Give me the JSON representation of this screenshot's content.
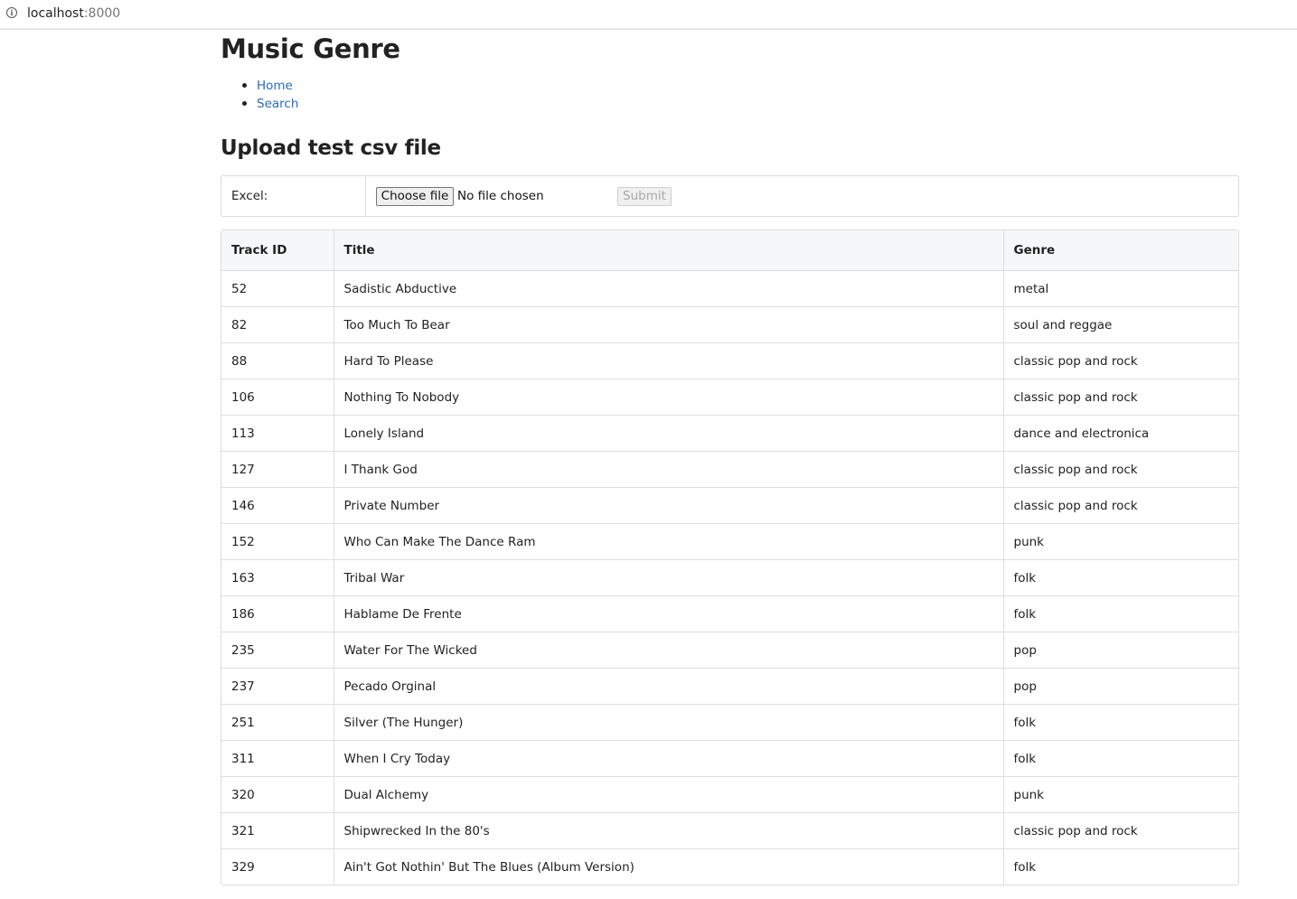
{
  "browser": {
    "url_host": "localhost",
    "url_port": ":8000"
  },
  "page": {
    "title": "Music Genre",
    "nav": [
      {
        "label": "Home"
      },
      {
        "label": "Search"
      }
    ],
    "upload_heading": "Upload test csv file",
    "upload_form": {
      "label": "Excel:",
      "choose_button": "Choose file",
      "file_status": "No file chosen",
      "submit_button": "Submit"
    }
  },
  "table": {
    "columns": [
      "Track ID",
      "Title",
      "Genre"
    ],
    "rows": [
      {
        "track_id": "52",
        "title": "Sadistic Abductive",
        "genre": "metal"
      },
      {
        "track_id": "82",
        "title": "Too Much To Bear",
        "genre": "soul and reggae"
      },
      {
        "track_id": "88",
        "title": "Hard To Please",
        "genre": "classic pop and rock"
      },
      {
        "track_id": "106",
        "title": "Nothing To Nobody",
        "genre": "classic pop and rock"
      },
      {
        "track_id": "113",
        "title": "Lonely Island",
        "genre": "dance and electronica"
      },
      {
        "track_id": "127",
        "title": "I Thank God",
        "genre": "classic pop and rock"
      },
      {
        "track_id": "146",
        "title": "Private Number",
        "genre": "classic pop and rock"
      },
      {
        "track_id": "152",
        "title": "Who Can Make The Dance Ram",
        "genre": "punk"
      },
      {
        "track_id": "163",
        "title": "Tribal War",
        "genre": "folk"
      },
      {
        "track_id": "186",
        "title": "Hablame De Frente",
        "genre": "folk"
      },
      {
        "track_id": "235",
        "title": "Water For The Wicked",
        "genre": "pop"
      },
      {
        "track_id": "237",
        "title": "Pecado Orginal",
        "genre": "pop"
      },
      {
        "track_id": "251",
        "title": "Silver (The Hunger)",
        "genre": "folk"
      },
      {
        "track_id": "311",
        "title": "When I Cry Today",
        "genre": "folk"
      },
      {
        "track_id": "320",
        "title": "Dual Alchemy",
        "genre": "punk"
      },
      {
        "track_id": "321",
        "title": "Shipwrecked In the 80's",
        "genre": "classic pop and rock"
      },
      {
        "track_id": "329",
        "title": "Ain't Got Nothin' But The Blues (Album Version)",
        "genre": "folk"
      }
    ]
  },
  "colors": {
    "link": "#2a6bb7",
    "border": "#dcdcdc",
    "header_bg": "#f6f7f8"
  }
}
